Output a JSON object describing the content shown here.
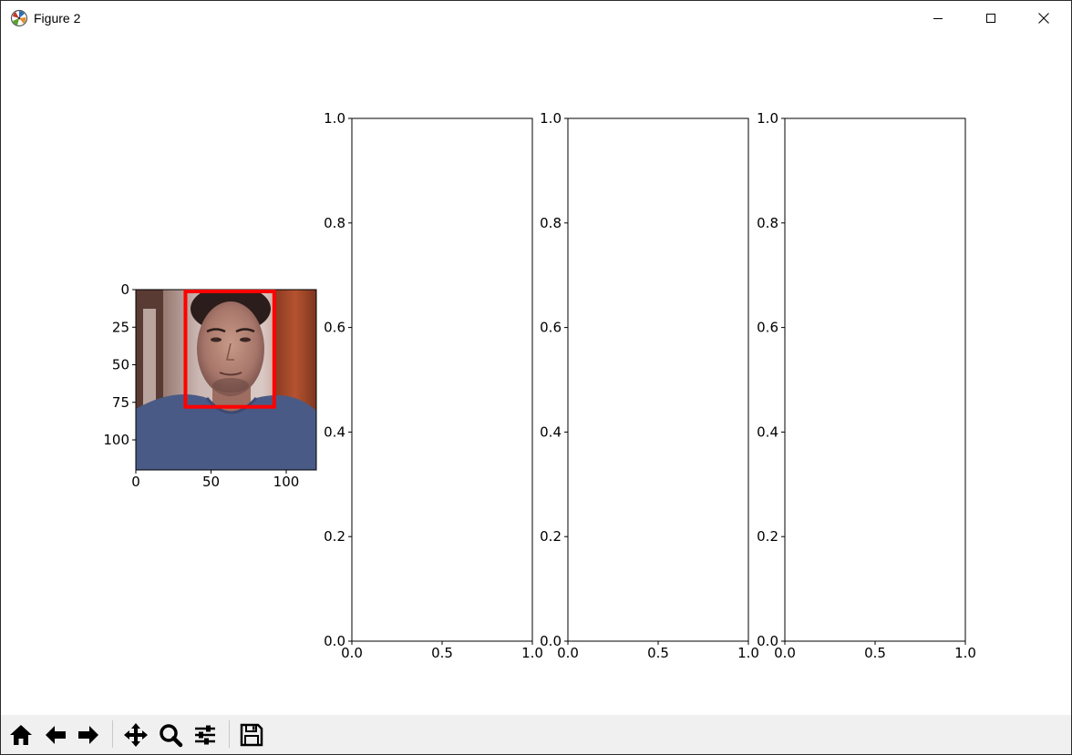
{
  "window": {
    "title": "Figure 2",
    "controls": [
      "minimize-icon",
      "maximize-icon",
      "close-icon"
    ]
  },
  "toolbar": {
    "buttons": [
      {
        "name": "home-button",
        "icon": "home-icon"
      },
      {
        "name": "back-button",
        "icon": "back-arrow-icon"
      },
      {
        "name": "forward-button",
        "icon": "forward-arrow-icon"
      },
      {
        "name": "pan-button",
        "icon": "move-icon"
      },
      {
        "name": "zoom-button",
        "icon": "magnifier-icon"
      },
      {
        "name": "configure-subplots-button",
        "icon": "sliders-icon"
      },
      {
        "name": "save-button",
        "icon": "floppy-disk-icon"
      }
    ]
  },
  "chart_data": [
    {
      "type": "image",
      "xticks": [
        "0",
        "50",
        "100"
      ],
      "yticks": [
        "0",
        "25",
        "50",
        "75",
        "100"
      ],
      "xlim": [
        0,
        120
      ],
      "ylim": [
        120,
        0
      ],
      "annotation": {
        "shape": "rectangle",
        "color": "#ff0000",
        "x0": 33,
        "x1": 92,
        "y0": 0,
        "y1": 78
      }
    },
    {
      "type": "empty",
      "xlim": [
        0,
        1
      ],
      "ylim": [
        0,
        1
      ],
      "xticks": [
        "0.0",
        "0.5",
        "1.0"
      ],
      "yticks": [
        "0.0",
        "0.2",
        "0.4",
        "0.6",
        "0.8",
        "1.0"
      ]
    },
    {
      "type": "empty",
      "xlim": [
        0,
        1
      ],
      "ylim": [
        0,
        1
      ],
      "xticks": [
        "0.0",
        "0.5",
        "1.0"
      ],
      "yticks": [
        "0.0",
        "0.2",
        "0.4",
        "0.6",
        "0.8",
        "1.0"
      ]
    },
    {
      "type": "empty",
      "xlim": [
        0,
        1
      ],
      "ylim": [
        0,
        1
      ],
      "xticks": [
        "0.0",
        "0.5",
        "1.0"
      ],
      "yticks": [
        "0.0",
        "0.2",
        "0.4",
        "0.6",
        "0.8",
        "1.0"
      ]
    }
  ]
}
